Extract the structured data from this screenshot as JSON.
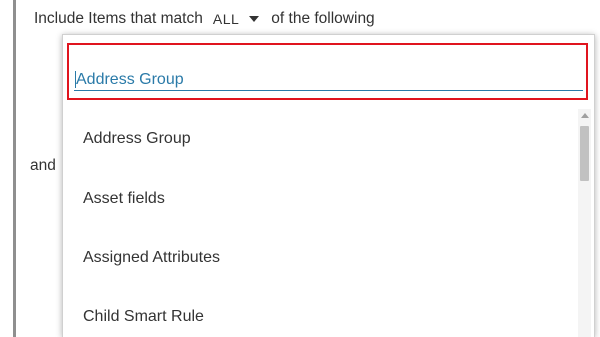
{
  "rule": {
    "prefix": "Include Items that match",
    "match_mode": "ALL",
    "suffix": "of the following",
    "connector": "and"
  },
  "dropdown": {
    "search_value": "Address Group",
    "options": [
      {
        "label": "Address Group"
      },
      {
        "label": "Asset fields"
      },
      {
        "label": "Assigned Attributes"
      },
      {
        "label": "Child Smart Rule"
      }
    ]
  },
  "colors": {
    "highlight_border": "#e0141e",
    "input_text": "#2a7aa8",
    "text": "#333333"
  },
  "icons": {
    "match_caret": "caret-down-icon",
    "scroll_up": "scroll-up-arrow-icon"
  }
}
